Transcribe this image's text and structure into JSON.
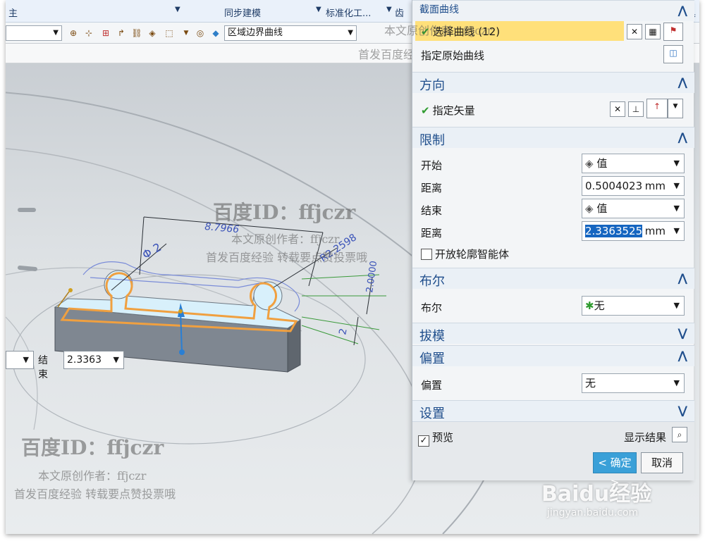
{
  "ribbon": {
    "left_glyph": "主",
    "tab_sync": "同步建模",
    "tab_standard": "标准化工...",
    "tab_cut": "齿",
    "right_glyph": "具"
  },
  "toolbar": {
    "curve_rule": "区域边界曲线"
  },
  "endbar": {
    "end_label": "结束",
    "end_value": "2.3363"
  },
  "panel": {
    "title_partial": "截面曲线",
    "select_curve": "选择曲线 (12)",
    "specify_original_curve": "指定原始曲线",
    "sections": {
      "direction": "方向",
      "limits": "限制",
      "boolean": "布尔",
      "draft": "拔模",
      "offset": "偏置",
      "settings": "设置"
    },
    "specify_vector": "指定矢量",
    "start_label": "开始",
    "start_option": "值",
    "distance_label": "距离",
    "start_distance": "0.5004023",
    "end_label": "结束",
    "end_option": "值",
    "end_distance": "2.3363525",
    "unit": "mm",
    "open_profile": "开放轮廓智能体",
    "boolean_label": "布尔",
    "boolean_option": "无",
    "offset_label": "偏置",
    "offset_option": "无",
    "preview": "预览",
    "show_result": "显示结果",
    "ok": "< 确定 >",
    "cancel": "取消"
  },
  "dimensions": {
    "length": "8.7966",
    "diameter": "Φ 2",
    "radius": "R2.2598",
    "height1": "2.0000",
    "height2": "2"
  },
  "watermarks": {
    "id_line": "百度ID：ffjczr",
    "author_line": "本文原创作者：ffjczr",
    "notice_line": "首发百度经验 转载要点赞投票哦",
    "baidu_brand": "Baidu经验",
    "baidu_url": "jingyan.baidu.com"
  },
  "colors": {
    "accent": "#1f4e8c",
    "selection": "#ffe07a",
    "primary_button": "#3aa0d8",
    "curve_highlight": "#f0a040"
  }
}
